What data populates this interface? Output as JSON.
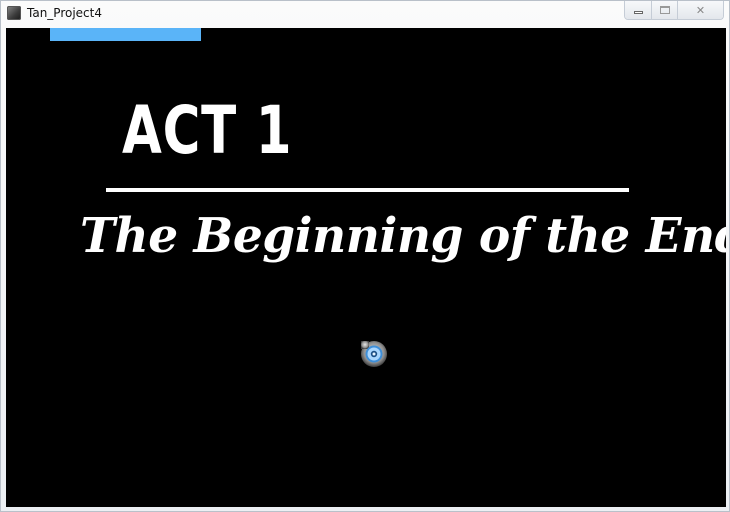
{
  "window": {
    "title": "Tan_Project4",
    "icon": "app-icon",
    "controls": {
      "minimize": "minimize-icon",
      "maximize": "maximize-icon",
      "close_label": "✕"
    }
  },
  "game": {
    "background_color": "#000000",
    "accent_color": "#5ab4f8",
    "act_title": "ACT 1",
    "subtitle": "The Beginning of the End",
    "loading_progress": 0.21,
    "spinner_icon": "loading-spinner-icon"
  }
}
